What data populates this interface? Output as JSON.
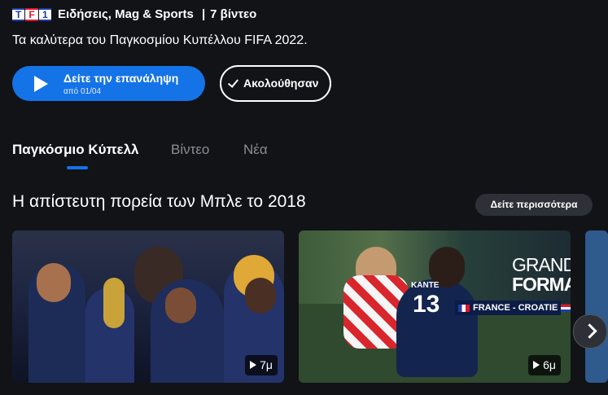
{
  "header": {
    "logo_letters": [
      "T",
      "F",
      "1"
    ],
    "channel": "Ειδήσεις, Mag & Sports",
    "video_count": "7 βίντεο"
  },
  "description": "Τα καλύτερα του Παγκοσμίου Κυπέλλου FIFA 2022.",
  "watch_button": {
    "label": "Δείτε την επανάληψη",
    "sub": "από 01/04"
  },
  "follow_button": {
    "label": "Ακολούθησαν"
  },
  "tabs": [
    {
      "label": "Παγκόσμιο Κύπελλ",
      "active": true
    },
    {
      "label": "Βίντεο",
      "active": false
    },
    {
      "label": "Νέα",
      "active": false
    }
  ],
  "section": {
    "title": "Η απίστευτη πορεία των Μπλε το 2018",
    "see_more": "Δείτε περισσότερα"
  },
  "cards": [
    {
      "duration": "7μ"
    },
    {
      "duration": "6μ",
      "overlay_title_1": "GRAND",
      "overlay_title_2": "FORMAT",
      "matchup": "FRANCE - CROATIE",
      "jersey_name": "KANTE",
      "jersey_number": "13"
    }
  ],
  "colors": {
    "accent": "#1473e6",
    "background": "#111317"
  }
}
